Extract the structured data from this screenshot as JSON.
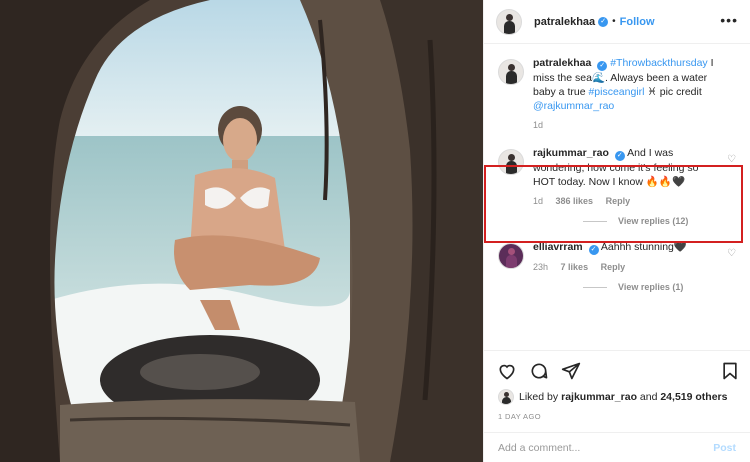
{
  "header": {
    "username": "patralekhaa",
    "separator": "•",
    "follow_label": "Follow",
    "more_icon": "ellipsis-icon"
  },
  "caption": {
    "username": "patralekhaa",
    "hashtag1": "#Throwbackthursday",
    "text1": " I miss the sea",
    "wave_emoji": "🌊",
    "text2": ". Always been a water baby a true ",
    "hashtag2": "#pisceangirl",
    "text3": " ♓ pic credit ",
    "mention": "@rajkummar_rao",
    "time": "1d"
  },
  "comments": [
    {
      "username": "rajkummar_rao",
      "text": "And I was wondering, how come it's feeling so HOT today. Now I know 🔥🔥🖤",
      "time": "1d",
      "likes": "386 likes",
      "reply_label": "Reply",
      "view_replies": "View replies (12)"
    },
    {
      "username": "elliavrram",
      "text": "Aahhh stunning🖤",
      "time": "23h",
      "likes": "7 likes",
      "reply_label": "Reply",
      "view_replies": "View replies (1)"
    }
  ],
  "likes_line": {
    "prefix": "Liked by ",
    "user": "rajkummar_rao",
    "middle": " and ",
    "count": "24,519 others"
  },
  "timestamp": "1 DAY AGO",
  "add_comment": {
    "placeholder": "Add a comment...",
    "post_label": "Post"
  },
  "colors": {
    "accent": "#3897f0",
    "highlight": "#d32020",
    "muted": "#8e8e8e"
  }
}
